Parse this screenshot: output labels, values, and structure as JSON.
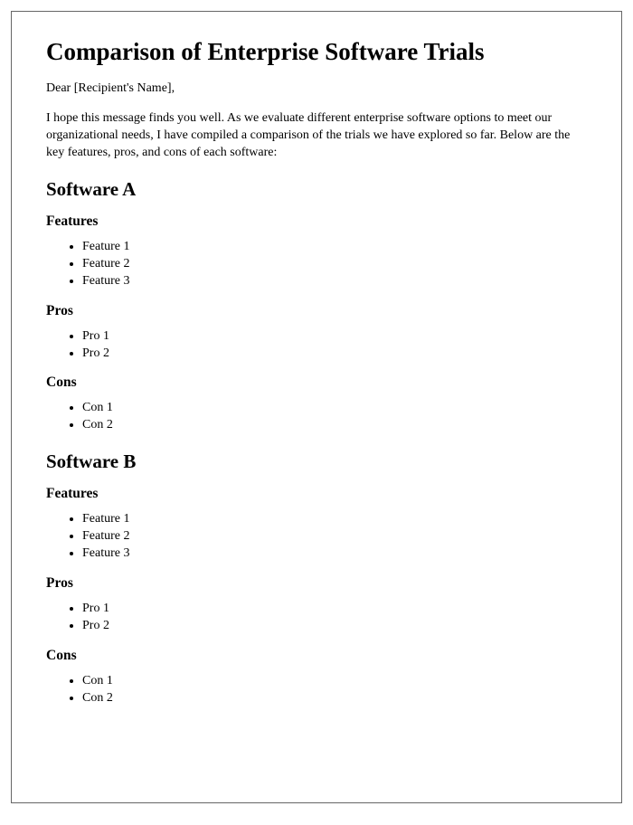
{
  "title": "Comparison of Enterprise Software Trials",
  "greeting": "Dear [Recipient's Name],",
  "intro": "I hope this message finds you well. As we evaluate different enterprise software options to meet our organizational needs, I have compiled a comparison of the trials we have explored so far. Below are the key features, pros, and cons of each software:",
  "labels": {
    "features": "Features",
    "pros": "Pros",
    "cons": "Cons"
  },
  "softwares": [
    {
      "name": "Software A",
      "features": [
        "Feature 1",
        "Feature 2",
        "Feature 3"
      ],
      "pros": [
        "Pro 1",
        "Pro 2"
      ],
      "cons": [
        "Con 1",
        "Con 2"
      ]
    },
    {
      "name": "Software B",
      "features": [
        "Feature 1",
        "Feature 2",
        "Feature 3"
      ],
      "pros": [
        "Pro 1",
        "Pro 2"
      ],
      "cons": [
        "Con 1",
        "Con 2"
      ]
    }
  ]
}
